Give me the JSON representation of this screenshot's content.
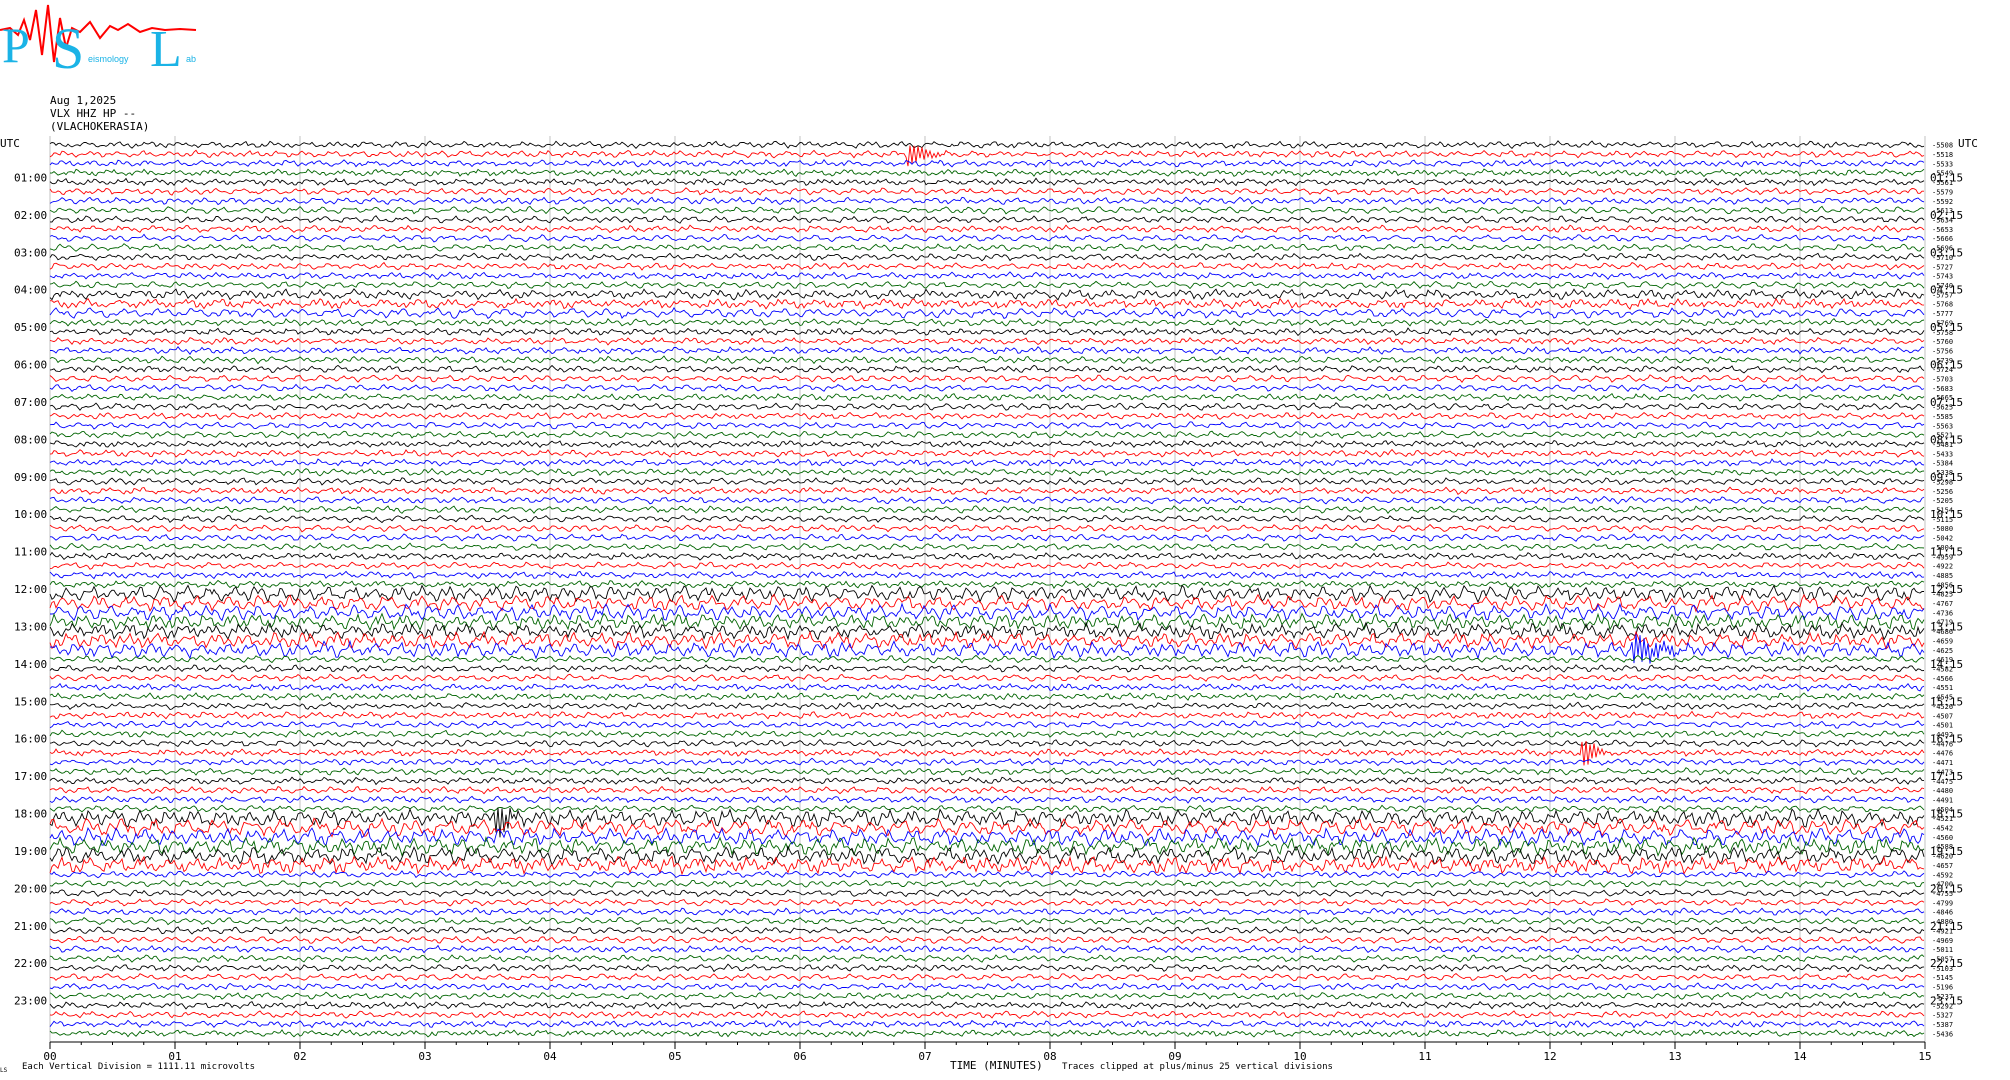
{
  "logo": {
    "letters": [
      "P",
      "S",
      "L"
    ],
    "small_text": [
      "eismology",
      "ab"
    ],
    "colors": {
      "letters": "#1ab3e6",
      "trace": "#ff0000"
    }
  },
  "header": {
    "date": "Aug 1,2025",
    "channel": "VLX HHZ HP --",
    "station": "(VLACHOKERASIA)"
  },
  "axis": {
    "left_title": "UTC",
    "right_title": "UTC",
    "x_label": "TIME (MINUTES)",
    "x_ticks": [
      "00",
      "01",
      "02",
      "03",
      "04",
      "05",
      "06",
      "07",
      "08",
      "09",
      "10",
      "11",
      "12",
      "13",
      "14",
      "15"
    ],
    "left_hours": [
      "01:00",
      "02:00",
      "03:00",
      "04:00",
      "05:00",
      "06:00",
      "07:00",
      "08:00",
      "09:00",
      "10:00",
      "11:00",
      "12:00",
      "13:00",
      "14:00",
      "15:00",
      "16:00",
      "17:00",
      "18:00",
      "19:00",
      "20:00",
      "21:00",
      "22:00",
      "23:00"
    ],
    "right_hours": [
      "01:15",
      "02:15",
      "03:15",
      "04:15",
      "05:15",
      "06:15",
      "07:15",
      "08:15",
      "09:15",
      "10:15",
      "11:15",
      "12:15",
      "13:15",
      "14:15",
      "15:15",
      "16:15",
      "17:15",
      "18:15",
      "19:15",
      "20:15",
      "21:15",
      "22:15",
      "23:15"
    ]
  },
  "footer": {
    "corner": "LS",
    "vertical_division": "Each Vertical Division = 1111.11 microvolts",
    "clip_note": "Traces clipped at plus/minus 25 vertical divisions"
  },
  "chart_data": {
    "type": "line",
    "title": "",
    "xlabel": "TIME (MINUTES)",
    "ylabel": "UTC",
    "xlim": [
      0,
      15
    ],
    "trace_minutes_per_line": 15,
    "lines_per_hour": 4,
    "hours": 24,
    "grid": "vertical",
    "trace_colors": [
      "#000000",
      "#ff0000",
      "#0000ff",
      "#006400"
    ],
    "right_values": [
      "-5508",
      "-5518",
      "-5533",
      "-5549",
      "-5561",
      "-5579",
      "-5592",
      "-5613",
      "-5634",
      "-5653",
      "-5666",
      "-5696",
      "-5710",
      "-5727",
      "-5743",
      "-5740",
      "-5757",
      "-5768",
      "-5777",
      "-5769",
      "-5758",
      "-5760",
      "-5756",
      "-5739",
      "-5724",
      "-5703",
      "-5683",
      "-5665",
      "-5625",
      "-5585",
      "-5563",
      "-5521",
      "-5481",
      "-5433",
      "-5384",
      "-5338",
      "-5298",
      "-5256",
      "-5205",
      "-5154",
      "-5115",
      "-5080",
      "-5042",
      "-5004",
      "-4959",
      "-4922",
      "-4885",
      "-4856",
      "-4825",
      "-4767",
      "-4736",
      "-4719",
      "-4686",
      "-4659",
      "-4625",
      "-4619",
      "-4582",
      "-4566",
      "-4551",
      "-4545",
      "-4526",
      "-4507",
      "-4501",
      "-4492",
      "-4476",
      "-4476",
      "-4471",
      "-4473",
      "-4475",
      "-4480",
      "-4491",
      "-4504",
      "-4521",
      "-4542",
      "-4560",
      "-4588",
      "-4620",
      "-4657",
      "-4592",
      "-4700",
      "-4755",
      "-4799",
      "-4846",
      "-4880",
      "-4921",
      "-4969",
      "-5011",
      "-5057",
      "-5103",
      "-5145",
      "-5196",
      "-5237",
      "-5292",
      "-5327",
      "-5387",
      "-5436"
    ],
    "events": [
      {
        "line": 1,
        "minute": 6.9,
        "color": "#ff0000",
        "amp": 1.2
      },
      {
        "line": 54,
        "minute": 12.7,
        "color": "#006400",
        "amp": 2.5
      },
      {
        "line": 65,
        "minute": 12.3,
        "color": "#ff0000",
        "amp": 2.0
      },
      {
        "line": 72,
        "minute": 3.6,
        "color": "#0000ff",
        "amp": 2.0
      }
    ]
  }
}
